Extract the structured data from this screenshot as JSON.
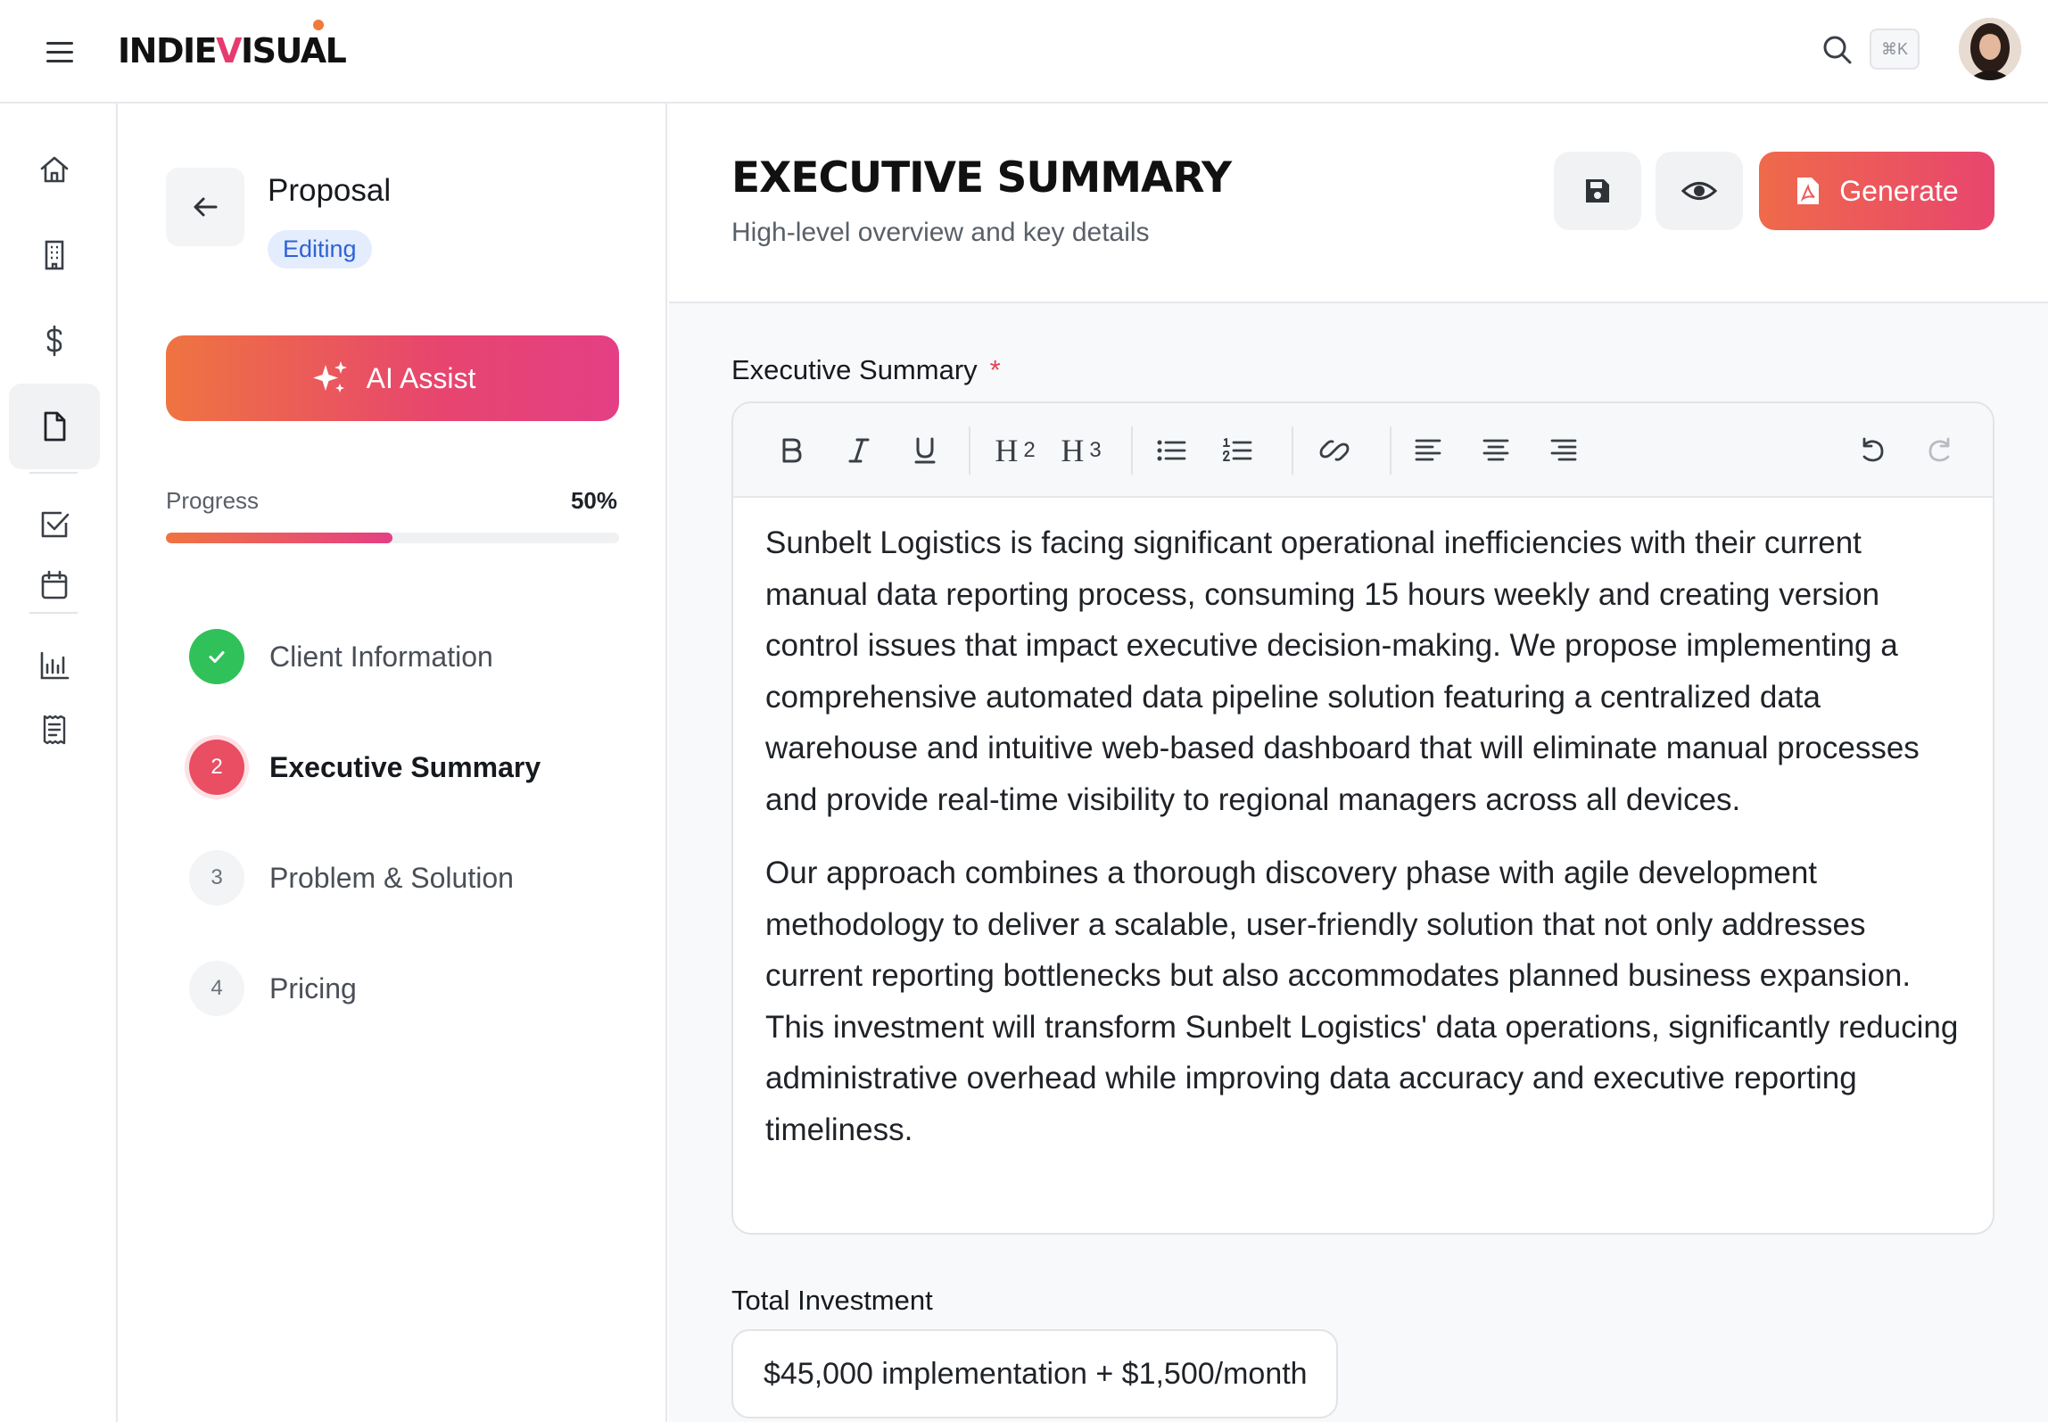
{
  "brand": {
    "logo_text_a": "INDIE",
    "logo_text_v": "V",
    "logo_text_b": "ISUAL"
  },
  "topbar": {
    "shortcut": "⌘K"
  },
  "rail": {
    "items": [
      "home",
      "buildings",
      "billing",
      "documents",
      "tasks",
      "calendar",
      "reports",
      "receipts"
    ],
    "active": "documents"
  },
  "panel": {
    "title": "Proposal",
    "status": "Editing",
    "ai_button": "AI Assist",
    "progress_label": "Progress",
    "progress_text": "50%",
    "progress_fraction": 0.5,
    "steps": [
      {
        "number": "1",
        "label": "Client Information",
        "state": "done"
      },
      {
        "number": "2",
        "label": "Executive Summary",
        "state": "current"
      },
      {
        "number": "3",
        "label": "Problem & Solution",
        "state": "todo"
      },
      {
        "number": "4",
        "label": "Pricing",
        "state": "todo"
      }
    ]
  },
  "main": {
    "title": "EXECUTIVE SUMMARY",
    "subtitle": "High-level overview and key details",
    "generate_label": "Generate"
  },
  "editor": {
    "label": "Executive Summary",
    "required_mark": "*",
    "toolbar": {
      "h2_num": "2",
      "h3_num": "3"
    },
    "paragraphs": [
      "Sunbelt Logistics is facing significant operational inefficiencies with their current manual data reporting process, consuming 15 hours weekly and creating version control issues that impact executive decision-making. We propose implementing a comprehensive automated data pipeline solution featuring a centralized data warehouse and intuitive web-based dashboard that will eliminate manual processes and provide real-time visibility to regional managers across all devices.",
      "Our approach combines a thorough discovery phase with agile development methodology to deliver a scalable, user-friendly solution that not only addresses current reporting bottlenecks but also accommodates planned business expansion. This investment will transform Sunbelt Logistics' data operations, significantly reducing administrative overhead while improving data accuracy and executive reporting timeliness."
    ]
  },
  "investment": {
    "label": "Total Investment",
    "value": "$45,000 implementation + $1,500/month"
  },
  "colors": {
    "accent_start": "#ef7441",
    "accent_end": "#e43f85",
    "success": "#31c15a",
    "badge_bg": "#e4edfd",
    "badge_text": "#2f62d6"
  }
}
